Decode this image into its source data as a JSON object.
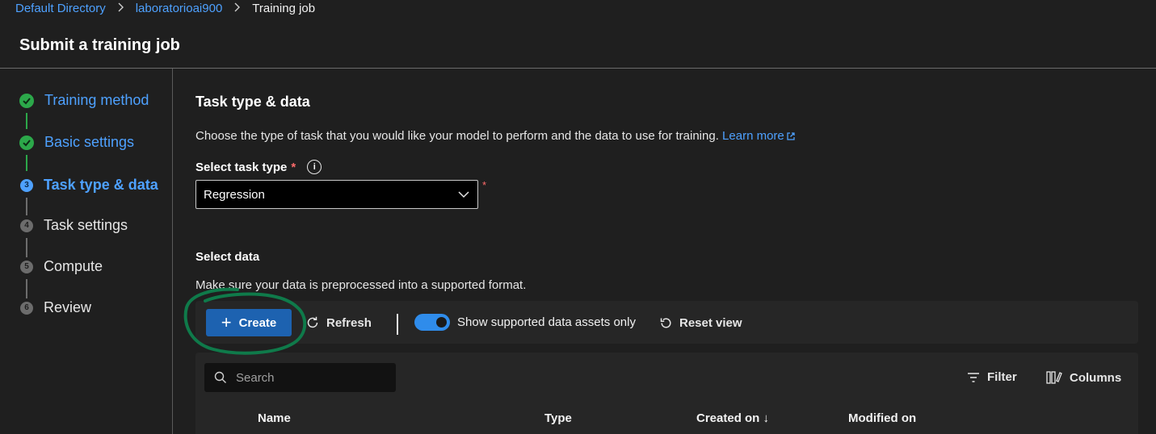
{
  "breadcrumb": {
    "items": [
      "Default Directory",
      "laboratorioai900"
    ],
    "current": "Training job",
    "separator": ">"
  },
  "page": {
    "title": "Submit a training job"
  },
  "wizard": {
    "steps": [
      {
        "label": "Training method",
        "number": "1",
        "state": "done"
      },
      {
        "label": "Basic settings",
        "number": "2",
        "state": "done"
      },
      {
        "label": "Task type & data",
        "number": "3",
        "state": "active"
      },
      {
        "label": "Task settings",
        "number": "4",
        "state": "todo"
      },
      {
        "label": "Compute",
        "number": "5",
        "state": "todo"
      },
      {
        "label": "Review",
        "number": "6",
        "state": "todo"
      }
    ]
  },
  "main": {
    "section_title": "Task type & data",
    "description": "Choose the type of task that you would like your model to perform and the data to use for training.",
    "learn_more": "Learn more",
    "task_type": {
      "label": "Select task type",
      "required_mark": "*",
      "info_glyph": "i",
      "value": "Regression"
    },
    "select_data": {
      "title": "Select data",
      "description": "Make sure your data is preprocessed into a supported format."
    },
    "toolbar": {
      "create_label": "Create",
      "refresh_label": "Refresh",
      "toggle_label": "Show supported data assets only",
      "toggle_on": true,
      "reset_label": "Reset view"
    },
    "grid": {
      "search_placeholder": "Search",
      "filter_label": "Filter",
      "columns_label": "Columns",
      "headers": [
        "Name",
        "Type",
        "Created on ↓",
        "Modified on"
      ]
    }
  },
  "colors": {
    "background": "#1f1f1f",
    "link": "#4ea1ff",
    "success": "#2ca84a",
    "primary_button": "#1d62b0",
    "annotation": "#0f7a4a"
  }
}
